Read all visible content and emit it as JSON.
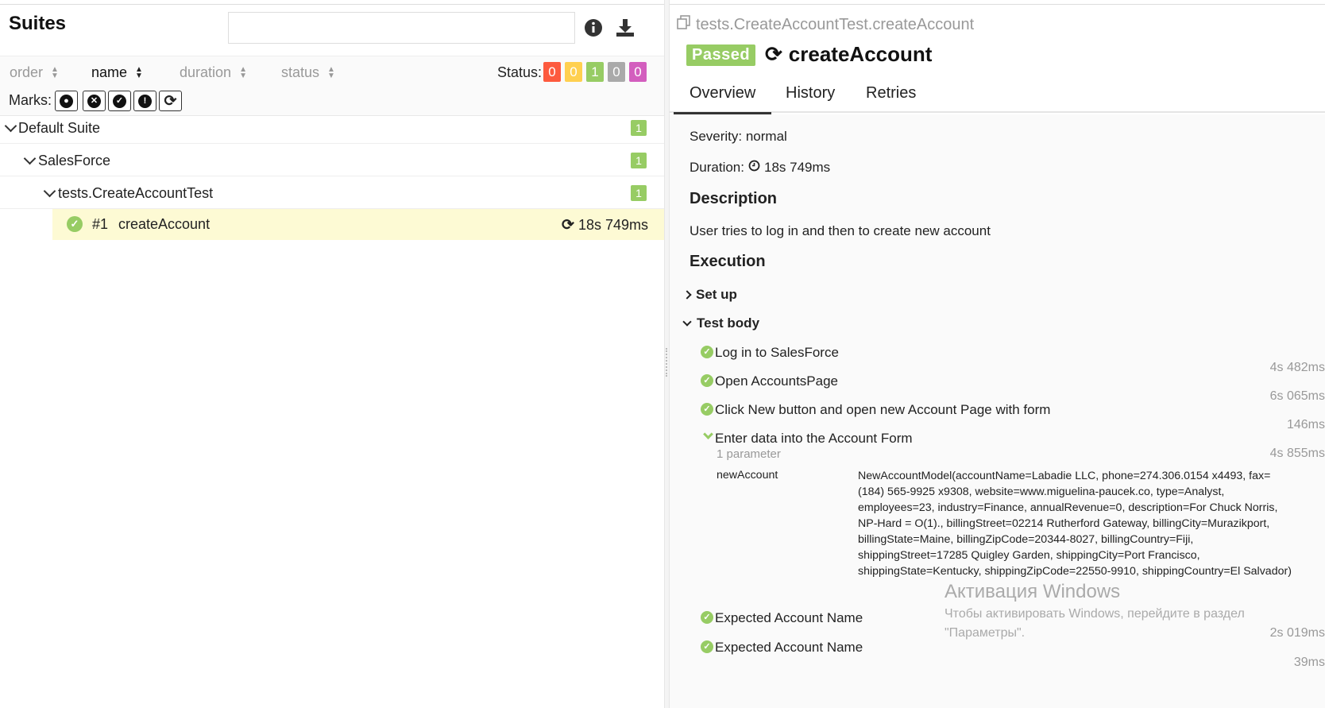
{
  "left": {
    "title": "Suites",
    "search_value": "",
    "sort": [
      {
        "label": "order",
        "active": false
      },
      {
        "label": "name",
        "active": true
      },
      {
        "label": "duration",
        "active": false
      },
      {
        "label": "status",
        "active": false
      }
    ],
    "status_label": "Status:",
    "status_counts": [
      {
        "value": "0",
        "color": "#fd5a3e"
      },
      {
        "value": "0",
        "color": "#ffd050"
      },
      {
        "value": "1",
        "color": "#97cc64"
      },
      {
        "value": "0",
        "color": "#aaaaaa"
      },
      {
        "value": "0",
        "color": "#d35ebe"
      }
    ],
    "marks_label": "Marks:",
    "tree": [
      {
        "label": "Default Suite",
        "count": "1"
      },
      {
        "label": "SalesForce",
        "count": "1"
      },
      {
        "label": "tests.CreateAccountTest",
        "count": "1"
      }
    ],
    "test": {
      "number": "#1",
      "name": "createAccount",
      "duration": "18s 749ms"
    }
  },
  "right": {
    "uid": "tests.CreateAccountTest.createAccount",
    "status": "Passed",
    "title": "createAccount",
    "tabs": [
      "Overview",
      "History",
      "Retries"
    ],
    "severity": "Severity: normal",
    "duration_label": "Duration:",
    "duration_value": "18s 749ms",
    "description_heading": "Description",
    "description": "User tries to log in and then to create new account",
    "execution_heading": "Execution",
    "setup_label": "Set up",
    "testbody_label": "Test body",
    "steps": [
      {
        "name": "Log in to SalesForce",
        "duration": "4s 482ms"
      },
      {
        "name": "Open AccountsPage",
        "duration": "6s 065ms"
      },
      {
        "name": "Click New button and open new Account Page with form",
        "duration": "146ms"
      },
      {
        "name": "Enter data into the Account Form",
        "duration": "4s 855ms"
      },
      {
        "name": "Expected Account Name",
        "duration": "2s 019ms"
      },
      {
        "name": "Expected Account Name",
        "duration": "39ms"
      }
    ],
    "param_count": "1 parameter",
    "param_name": "newAccount",
    "param_value": "NewAccountModel(accountName=Labadie LLC, phone=274.306.0154 x4493, fax=(184) 565-9925 x9308, website=www.miguelina-paucek.co, type=Analyst, employees=23, industry=Finance, annualRevenue=0, description=For Chuck Norris, NP-Hard = O(1)., billingStreet=02214 Rutherford Gateway, billingCity=Murazikport, billingState=Maine, billingZipCode=20344-8027, billingCountry=Fiji, shippingStreet=17285 Quigley Garden, shippingCity=Port Francisco, shippingState=Kentucky, shippingZipCode=22550-9910, shippingCountry=El Salvador)"
  },
  "watermark": {
    "title": "Активация Windows",
    "text1": "Чтобы активировать Windows, перейдите в раздел",
    "text2": "\"Параметры\"."
  },
  "icons": [
    "info-icon",
    "download-icon",
    "copy-icon",
    "retry-icon",
    "clock-icon",
    "check-icon",
    "chevron-down-icon",
    "chevron-right-icon",
    "bomb-icon",
    "close-circle-icon",
    "check-circle-icon",
    "exclamation-icon"
  ]
}
